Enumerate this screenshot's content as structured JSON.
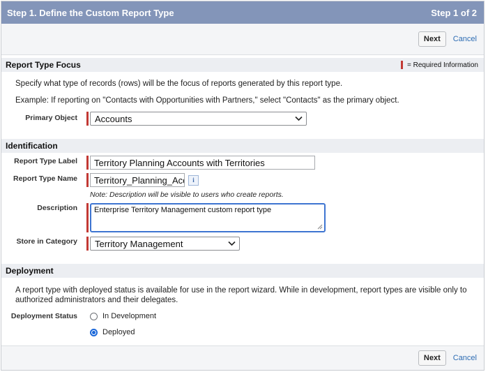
{
  "header": {
    "title": "Step 1. Define the Custom Report Type",
    "step": "Step 1 of 2"
  },
  "actions": {
    "next_label": "Next",
    "cancel_label": "Cancel"
  },
  "focus": {
    "heading": "Report Type Focus",
    "required_legend": "= Required Information",
    "description": "Specify what type of records (rows) will be the focus of reports generated by this report type.",
    "example": "Example: If reporting on \"Contacts with Opportunities with Partners,\" select \"Contacts\" as the primary object.",
    "primary_object_label": "Primary Object",
    "primary_object_value": "Accounts"
  },
  "identification": {
    "heading": "Identification",
    "label_label": "Report Type Label",
    "label_value": "Territory Planning Accounts with Territories",
    "name_label": "Report Type Name",
    "name_value": "Territory_Planning_Acc",
    "note": "Note: Description will be visible to users who create reports.",
    "description_label": "Description",
    "description_value": "Enterprise Territory Management custom report type",
    "category_label": "Store in Category",
    "category_value": "Territory Management"
  },
  "deployment": {
    "heading": "Deployment",
    "text": "A report type with deployed status is available for use in the report wizard. While in development, report types are visible only to authorized administrators and their delegates.",
    "status_label": "Deployment Status",
    "options": [
      {
        "label": "In Development",
        "selected": false
      },
      {
        "label": "Deployed",
        "selected": true
      }
    ]
  },
  "icons": {
    "info": "info-icon",
    "dropdown": "chevron-down-icon"
  },
  "colors": {
    "header_bg": "#8395b9",
    "required": "#c23934",
    "link": "#2d6cb3",
    "focus_border": "#3e75d1"
  }
}
